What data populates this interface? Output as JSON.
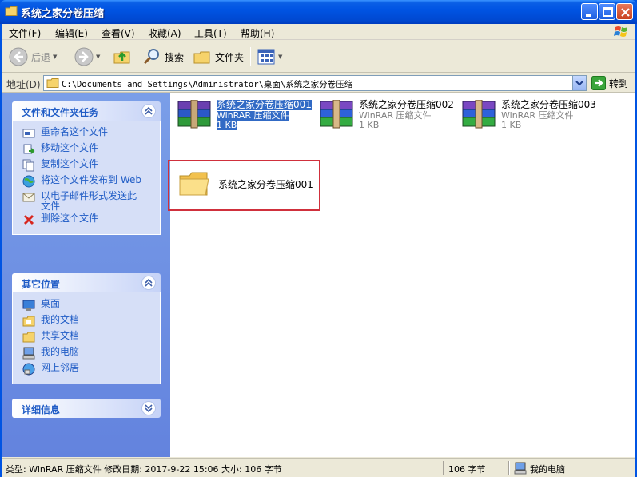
{
  "window": {
    "title": "系统之家分卷压缩"
  },
  "menu": [
    "文件(F)",
    "编辑(E)",
    "查看(V)",
    "收藏(A)",
    "工具(T)",
    "帮助(H)"
  ],
  "toolbar": {
    "back": "后退",
    "search": "搜索",
    "folders": "文件夹"
  },
  "address": {
    "label": "地址(D)",
    "path": "C:\\Documents and Settings\\Administrator\\桌面\\系统之家分卷压缩",
    "go": "转到"
  },
  "tasks_panel": {
    "title": "文件和文件夹任务",
    "items": [
      {
        "label": "重命名这个文件",
        "icon": "rename-icon"
      },
      {
        "label": "移动这个文件",
        "icon": "move-icon"
      },
      {
        "label": "复制这个文件",
        "icon": "copy-icon"
      },
      {
        "label": "将这个文件发布到 Web",
        "icon": "publish-web-icon"
      },
      {
        "label": "以电子邮件形式发送此文件",
        "icon": "email-icon"
      },
      {
        "label": "删除这个文件",
        "icon": "delete-icon"
      }
    ]
  },
  "places_panel": {
    "title": "其它位置",
    "items": [
      {
        "label": "桌面",
        "icon": "desktop-icon"
      },
      {
        "label": "我的文档",
        "icon": "my-documents-icon"
      },
      {
        "label": "共享文档",
        "icon": "shared-documents-icon"
      },
      {
        "label": "我的电脑",
        "icon": "my-computer-icon"
      },
      {
        "label": "网上邻居",
        "icon": "network-icon"
      }
    ]
  },
  "details_panel": {
    "title": "详细信息"
  },
  "files": [
    {
      "name": "系统之家分卷压缩001",
      "type": "WinRAR 压缩文件",
      "size": "1 KB",
      "selected": true
    },
    {
      "name": "系统之家分卷压缩002",
      "type": "WinRAR 压缩文件",
      "size": "1 KB",
      "selected": false
    },
    {
      "name": "系统之家分卷压缩003",
      "type": "WinRAR 压缩文件",
      "size": "1 KB",
      "selected": false
    }
  ],
  "folder": {
    "name": "系统之家分卷压缩001"
  },
  "status": {
    "info": "类型: WinRAR 压缩文件 修改日期: 2017-9-22 15:06 大小: 106 字节",
    "size": "106 字节",
    "zone": "我的电脑"
  },
  "colors": {
    "titlebar": "#0054e3",
    "panel_link": "#215dc6",
    "selection": "#316ac5",
    "highlight_box": "#d0303c"
  }
}
